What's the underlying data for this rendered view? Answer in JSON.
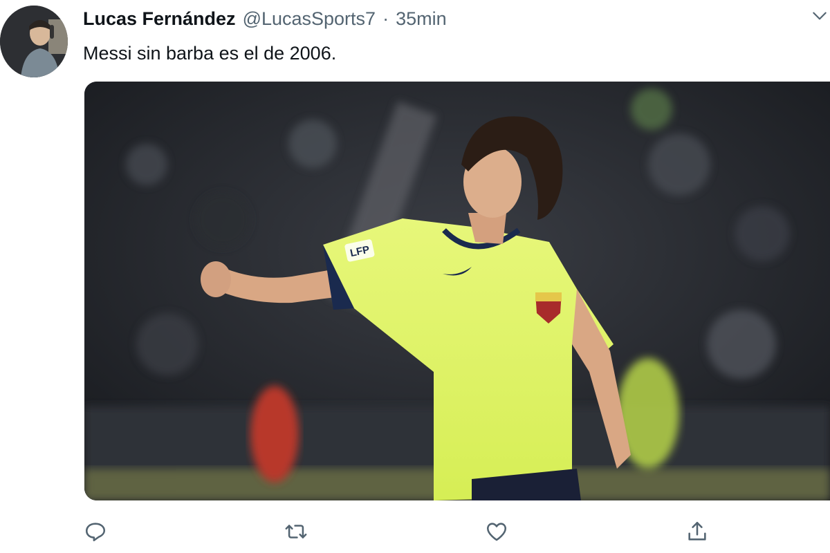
{
  "tweet": {
    "author": {
      "name": "Lucas Fernández",
      "handle": "@LucasSports7"
    },
    "separator": "·",
    "time": "35min",
    "text": "Messi sin barba es el de 2006.",
    "media": {
      "jersey_badge_text": "LFP"
    }
  },
  "icons": {
    "more": "chevron-down-icon",
    "reply": "reply-icon",
    "retweet": "retweet-icon",
    "like": "heart-icon",
    "share": "share-icon"
  },
  "colors": {
    "text_primary": "#0f1419",
    "text_secondary": "#536471",
    "icon": "#536471"
  }
}
